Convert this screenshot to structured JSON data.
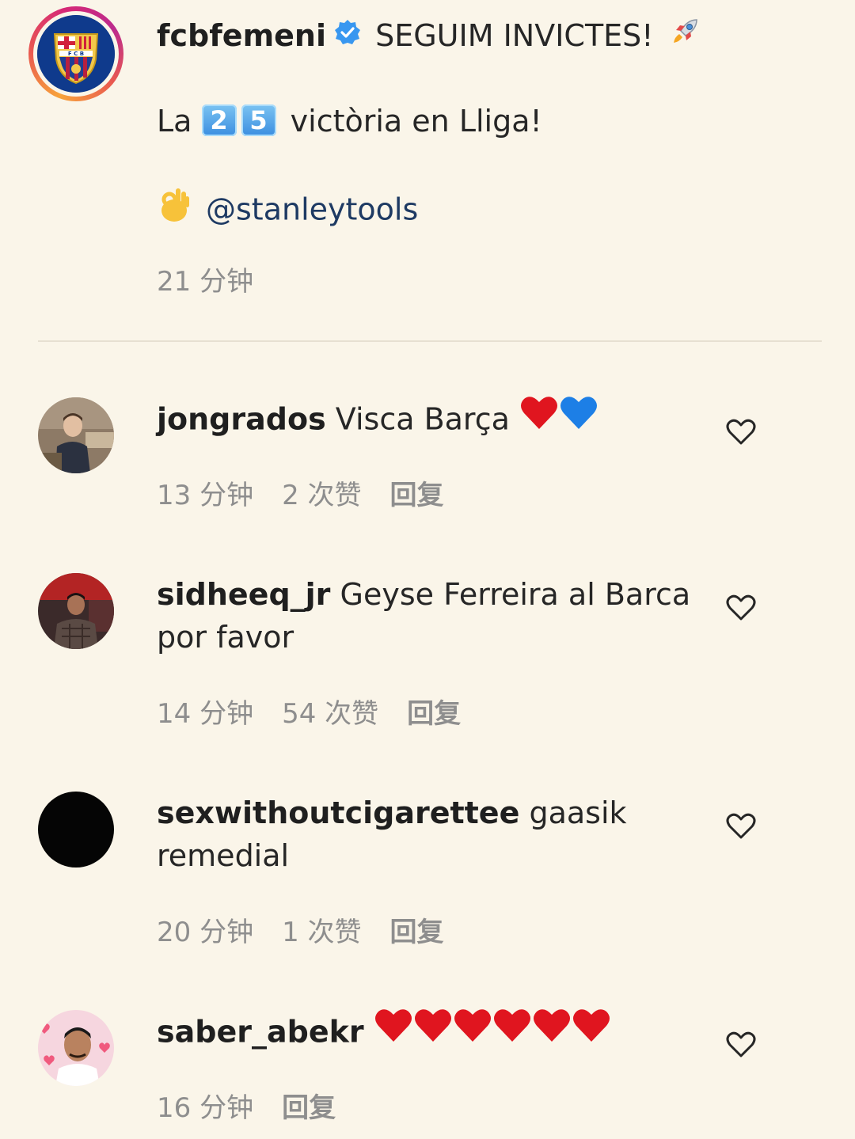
{
  "caption": {
    "username": "fcbfemeni",
    "line1_text": "SEGUIM INVICTES!",
    "line2_prefix": "La",
    "digit_a": "2",
    "digit_b": "5",
    "line2_suffix": "victòria en Lliga!",
    "mention": "@stanleytools",
    "time": "21 分钟"
  },
  "comments": [
    {
      "username": "jongrados",
      "text": "Visca Barça",
      "time": "13 分钟",
      "likes": "2 次赞",
      "reply": "回复",
      "avatar_color": "#6b5a4a"
    },
    {
      "username": "sidheeq_jr",
      "text": "Geyse Ferreira al Barca por favor",
      "time": "14 分钟",
      "likes": "54 次赞",
      "reply": "回复",
      "avatar_color": "#7a2a2a"
    },
    {
      "username": "sexwithoutcigarettee",
      "text": "gaasik remedial",
      "time": "20 分钟",
      "likes": "1 次赞",
      "reply": "回复",
      "avatar_color": "#050505"
    },
    {
      "username": "saber_abekr",
      "text": "",
      "time": "16 分钟",
      "reply": "回复",
      "avatar_color": "#f4c2cf"
    }
  ],
  "icons": {
    "verified": "verified-badge-icon",
    "rocket": "rocket-icon",
    "ok_hand": "ok-hand-icon",
    "like": "heart-outline-icon"
  },
  "colors": {
    "background": "#faf5e9",
    "muted": "#8e8e8e",
    "mention": "#1e3a63",
    "red_heart": "#e0151f",
    "blue_heart": "#1d7fe6"
  }
}
